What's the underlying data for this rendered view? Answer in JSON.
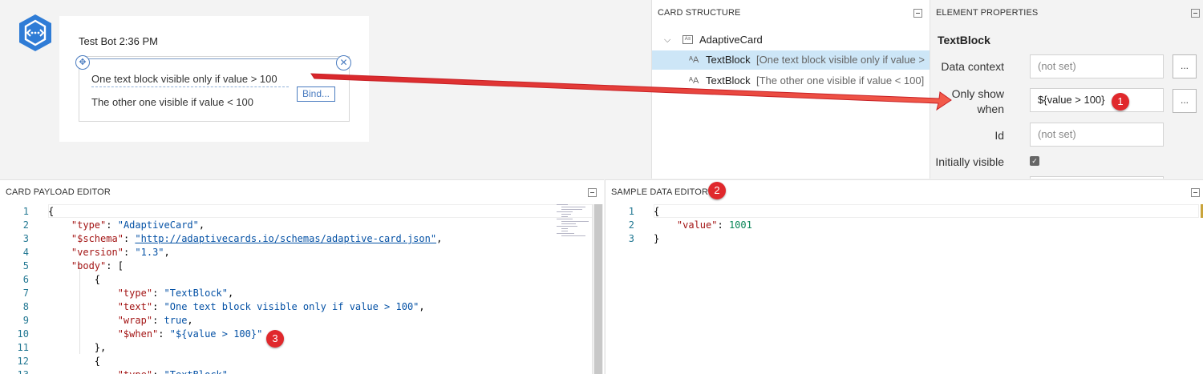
{
  "preview": {
    "header": "Test Bot 2:36 PM",
    "textblock1": "One text block visible only if value > 100",
    "textblock2": "The other one visible if value < 100",
    "bind_label": "Bind..."
  },
  "structure": {
    "title": "CARD STRUCTURE",
    "root": "AdaptiveCard",
    "items": [
      {
        "name": "TextBlock",
        "desc": "[One text block visible only if value >"
      },
      {
        "name": "TextBlock",
        "desc": "[The other one visible if value < 100]"
      }
    ]
  },
  "properties": {
    "title": "ELEMENT PROPERTIES",
    "element": "TextBlock",
    "data_context_label": "Data context",
    "data_context_value": "(not set)",
    "only_show_label_1": "Only show",
    "only_show_label_2": "when",
    "only_show_value": "${value > 100}",
    "id_label": "Id",
    "id_value": "(not set)",
    "initially_visible_label": "Initially visible",
    "initially_visible_checked": true,
    "dots": "..."
  },
  "payload_editor": {
    "title": "CARD PAYLOAD EDITOR",
    "line_numbers": [
      "1",
      "2",
      "3",
      "4",
      "5",
      "6",
      "7",
      "8",
      "9",
      "10",
      "11",
      "12",
      "13"
    ]
  },
  "data_editor": {
    "title": "SAMPLE DATA EDITOR",
    "line_numbers": [
      "1",
      "2",
      "3"
    ]
  },
  "badges": [
    "1",
    "2",
    "3"
  ],
  "colors": {
    "accent": "#4a7cc0",
    "selection": "#cde6f7",
    "badge": "#e0282c",
    "arrow": "#e53b33",
    "json_key": "#a31515",
    "json_string": "#0451a5",
    "json_number": "#098658"
  }
}
